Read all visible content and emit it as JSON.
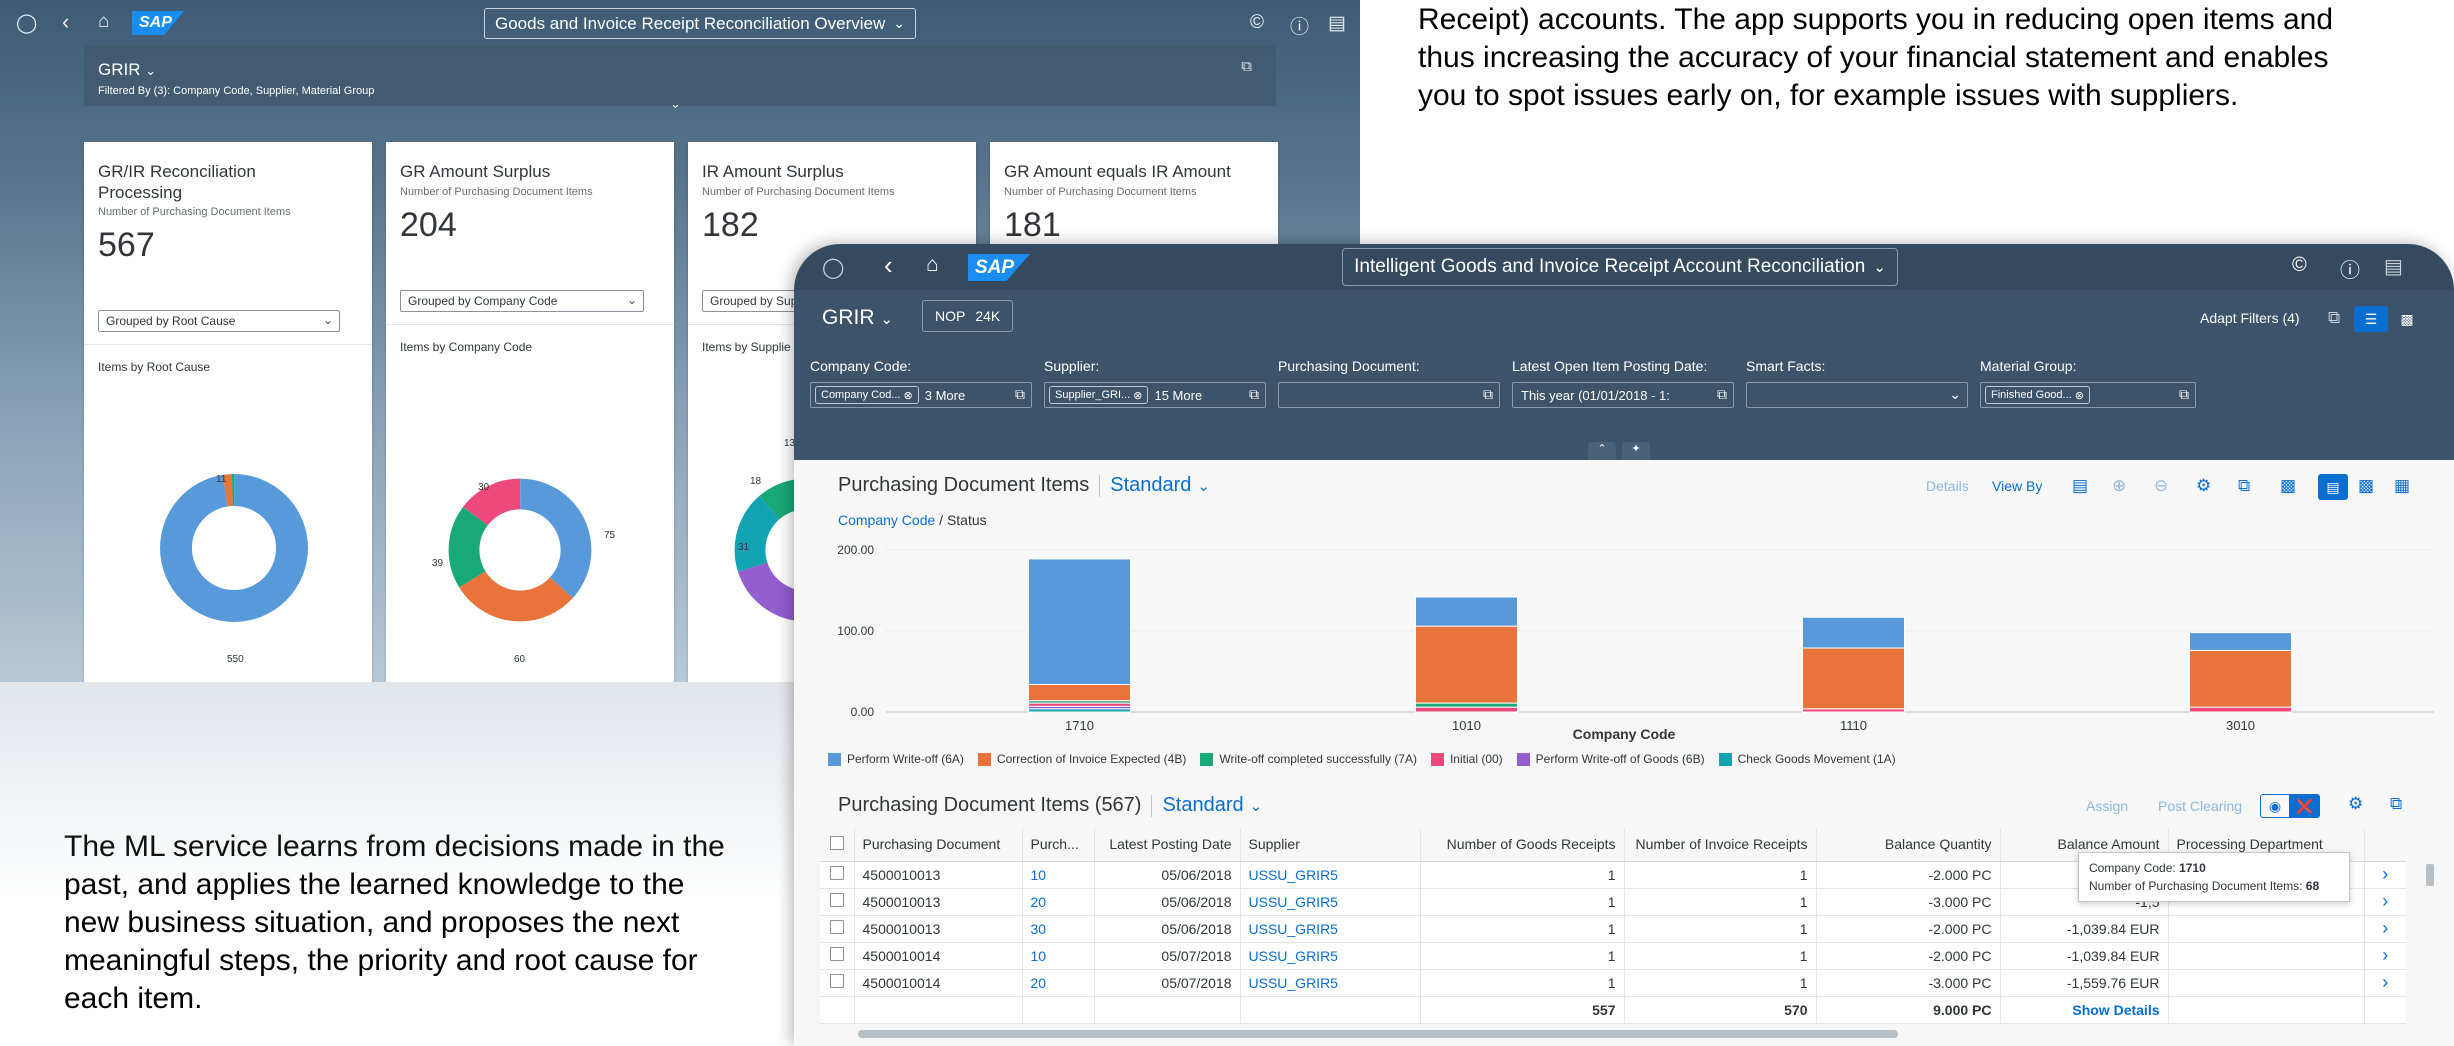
{
  "intro_text": "Receipt) accounts. The app supports you in reducing open items and thus increasing the accuracy of your financial statement and enables you to spot issues early on, for example issues with suppliers.",
  "ml_text": "The ML service learns from decisions made in the past, and applies the learned knowledge to the new business situation, and proposes the next meaningful steps, the priority and root cause for each item.",
  "overview_app": {
    "shell": {
      "logo": "SAP",
      "title": "Goods and Invoice Receipt Reconciliation Overview"
    },
    "header": {
      "variant": "GRIR",
      "filtered_by": "Filtered By (3): Company Code, Supplier, Material Group"
    },
    "cards": [
      {
        "title": "GR/IR Reconciliation Processing",
        "subtitle": "Number of Purchasing Document Items",
        "kpi": "567",
        "dropdown": "Grouped by Root Cause",
        "chart_label": "Items by Root Cause",
        "labels": [
          "11",
          "550"
        ]
      },
      {
        "title": "GR Amount Surplus",
        "subtitle": "Number of Purchasing Document Items",
        "kpi": "204",
        "dropdown": "Grouped by Company Code",
        "chart_label": "Items by Company Code",
        "labels": [
          "30",
          "75",
          "39",
          "60"
        ]
      },
      {
        "title": "IR Amount Surplus",
        "subtitle": "Number of Purchasing Document Items",
        "kpi": "182",
        "dropdown": "Grouped by Sup",
        "chart_label": "Items by Supplie",
        "labels": [
          "18",
          "13",
          "31"
        ]
      },
      {
        "title": "GR Amount equals IR Amount",
        "subtitle": "Number of Purchasing Document Items",
        "kpi": "181"
      }
    ],
    "donuts": [
      {
        "values": [
          550,
          11,
          3
        ],
        "colors": [
          "#5899da",
          "#e8743b",
          "#19a979"
        ]
      },
      {
        "values": [
          75,
          60,
          39,
          30
        ],
        "colors": [
          "#5899da",
          "#e8743b",
          "#19a979",
          "#ed4a7b"
        ]
      },
      {
        "values": [
          31,
          18,
          13,
          8
        ],
        "colors": [
          "#ed4a7b",
          "#945ecf",
          "#13a4b4",
          "#19a979"
        ]
      }
    ]
  },
  "recon_app": {
    "shell": {
      "logo": "SAP",
      "title": "Intelligent Goods and Invoice Receipt Account Reconciliation"
    },
    "variant": "GRIR",
    "kpi_tag": {
      "label": "NOP",
      "value": "24K"
    },
    "adapt_filters": "Adapt Filters (4)",
    "filters": [
      {
        "label": "Company Code:",
        "token": "Company Cod...",
        "more": "3 More"
      },
      {
        "label": "Supplier:",
        "token": "Supplier_GRI...",
        "more": "15 More"
      },
      {
        "label": "Purchasing Document:",
        "value": ""
      },
      {
        "label": "Latest Open Item Posting Date:",
        "value": "This year (01/01/2018 - 1:"
      },
      {
        "label": "Smart Facts:",
        "value": ""
      },
      {
        "label": "Material Group:",
        "token": "Finished Good..."
      }
    ],
    "chart_section": {
      "title": "Purchasing Document Items",
      "variant": "Standard",
      "details": "Details",
      "view_by": "View By",
      "breadcrumb_link": "Company Code",
      "breadcrumb_rest": "/ Status",
      "xlabel": "Company Code"
    },
    "table_section": {
      "title": "Purchasing Document Items (567)",
      "variant": "Standard",
      "assign": "Assign",
      "post_clearing": "Post Clearing",
      "show_details": "Show Details",
      "columns": [
        "Purchasing Document",
        "Purch...",
        "Latest Posting Date",
        "Supplier",
        "Number of Goods Receipts",
        "Number of Invoice Receipts",
        "Balance Quantity",
        "Balance Amount",
        "Processing Department"
      ],
      "rows": [
        [
          "4500010013",
          "10",
          "05/06/2018",
          "USSU_GRIR5",
          "1",
          "1",
          "-2.000 PC",
          "-1,0",
          ""
        ],
        [
          "4500010013",
          "20",
          "05/06/2018",
          "USSU_GRIR5",
          "1",
          "1",
          "-3.000 PC",
          "-1,5",
          ""
        ],
        [
          "4500010013",
          "30",
          "05/06/2018",
          "USSU_GRIR5",
          "1",
          "1",
          "-2.000 PC",
          "-1,039.84 EUR",
          ""
        ],
        [
          "4500010014",
          "10",
          "05/07/2018",
          "USSU_GRIR5",
          "1",
          "1",
          "-2.000 PC",
          "-1,039.84 EUR",
          ""
        ],
        [
          "4500010014",
          "20",
          "05/07/2018",
          "USSU_GRIR5",
          "1",
          "1",
          "-3.000 PC",
          "-1,559.76 EUR",
          ""
        ]
      ],
      "totals": {
        "goods": "557",
        "invoice": "570",
        "qty": "9.000 PC"
      }
    },
    "tooltip": {
      "line1_label": "Company Code:",
      "line1_value": "1710",
      "line2_label": "Number of Purchasing Document Items:",
      "line2_value": "68"
    }
  },
  "chart_data": {
    "type": "bar",
    "stacked": true,
    "categories": [
      "1710",
      "1010",
      "1110",
      "3010"
    ],
    "xlabel": "Company Code",
    "ylim": [
      0,
      200
    ],
    "yticks": [
      "0.00",
      "100.00",
      "200.00"
    ],
    "legend_position": "bottom",
    "series": [
      {
        "name": "Check Goods Movement (1A)",
        "color": "#13a4b4",
        "values": [
          4,
          0,
          0,
          0
        ]
      },
      {
        "name": "Perform Write-off of Goods (6B)",
        "color": "#945ecf",
        "values": [
          3,
          0,
          0,
          0
        ]
      },
      {
        "name": "Initial (00)",
        "color": "#ed4a7b",
        "values": [
          4,
          6,
          4,
          6
        ]
      },
      {
        "name": "Write-off completed successfully (7A)",
        "color": "#19a979",
        "values": [
          3,
          5,
          0,
          0
        ]
      },
      {
        "name": "Correction of Invoice Expected (4B)",
        "color": "#e8743b",
        "values": [
          20,
          95,
          75,
          70
        ]
      },
      {
        "name": "Perform Write-off (6A)",
        "color": "#5899da",
        "values": [
          155,
          36,
          38,
          22
        ]
      }
    ],
    "legend_order": [
      "Perform Write-off (6A)",
      "Correction of Invoice Expected (4B)",
      "Write-off completed successfully (7A)",
      "Initial (00)",
      "Perform Write-off of Goods (6B)",
      "Check Goods Movement (1A)"
    ]
  }
}
